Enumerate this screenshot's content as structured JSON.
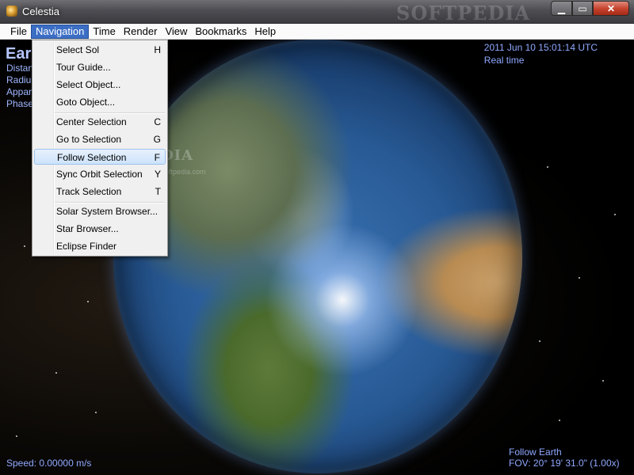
{
  "window": {
    "title": "Celestia",
    "watermark": "SOFTPEDIA",
    "minimize_glyph": "▁",
    "maximize_glyph": "▭",
    "close_glyph": "✕"
  },
  "menubar": {
    "items": [
      "File",
      "Navigation",
      "Time",
      "Render",
      "View",
      "Bookmarks",
      "Help"
    ]
  },
  "hud": {
    "object_name": "Ear",
    "lines": [
      "Distan",
      "Radiu",
      "Appar",
      "Phase"
    ],
    "datetime": "2011 Jun 10 15:01:14 UTC",
    "time_mode": "Real time",
    "speed": "Speed: 0.00000 m/s",
    "follow": "Follow Earth",
    "fov": "FOV: 20° 19' 31.0\" (1.00x)",
    "overlay_watermark": "SOFTPEDIA",
    "overlay_watermark_sub": "www.softpedia.com"
  },
  "navigation_menu": {
    "items": [
      {
        "label": "Select Sol",
        "key": "H"
      },
      {
        "label": "Tour Guide...",
        "key": ""
      },
      {
        "label": "Select Object...",
        "key": ""
      },
      {
        "label": "Goto Object...",
        "key": ""
      },
      {
        "label": "Center Selection",
        "key": "C"
      },
      {
        "label": "Go to Selection",
        "key": "G"
      },
      {
        "label": "Follow Selection",
        "key": "F"
      },
      {
        "label": "Sync Orbit Selection",
        "key": "Y"
      },
      {
        "label": "Track Selection",
        "key": "T"
      },
      {
        "label": "Solar System Browser...",
        "key": ""
      },
      {
        "label": "Star Browser...",
        "key": ""
      },
      {
        "label": "Eclipse Finder",
        "key": ""
      }
    ],
    "highlighted_index": 6
  },
  "colors": {
    "menu_active": "#3b6ec4",
    "hud_text": "#8fa8ff",
    "highlight": "#cde3fb"
  }
}
